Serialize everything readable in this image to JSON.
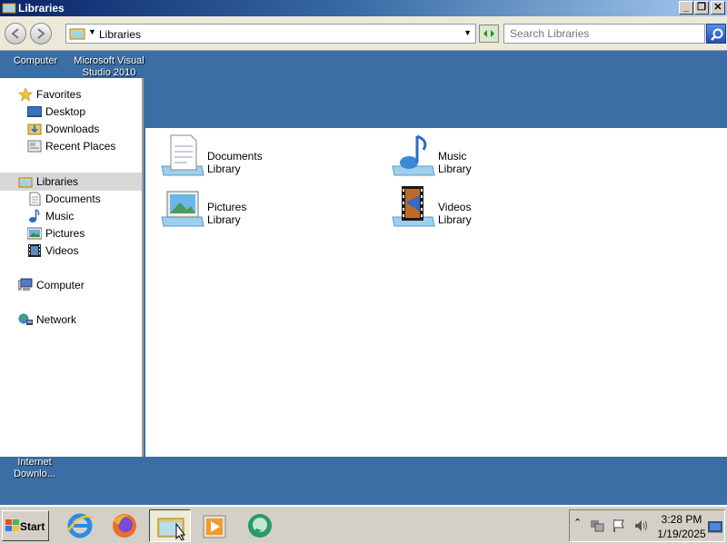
{
  "window": {
    "title": "Libraries",
    "controls": {
      "minimize": "_",
      "restore": "❐",
      "close": "✕"
    }
  },
  "address": {
    "path": "Libraries"
  },
  "search": {
    "placeholder": "Search Libraries"
  },
  "desktop_icons": [
    {
      "label": "Computer"
    },
    {
      "label": "Microsoft Visual Studio 2010"
    },
    {
      "label": "Internet Downlo..."
    }
  ],
  "navpane": {
    "favorites": {
      "label": "Favorites",
      "items": [
        "Desktop",
        "Downloads",
        "Recent Places"
      ]
    },
    "libraries": {
      "label": "Libraries",
      "items": [
        "Documents",
        "Music",
        "Pictures",
        "Videos"
      ]
    },
    "computer": "Computer",
    "network": "Network"
  },
  "libraries": [
    {
      "name": "Documents",
      "type": "Library",
      "icon": "documents-library-icon"
    },
    {
      "name": "Music",
      "type": "Library",
      "icon": "music-library-icon"
    },
    {
      "name": "Pictures",
      "type": "Library",
      "icon": "pictures-library-icon"
    },
    {
      "name": "Videos",
      "type": "Library",
      "icon": "videos-library-icon"
    }
  ],
  "taskbar": {
    "start_label": "Start",
    "apps": [
      "internet-explorer-icon",
      "firefox-icon",
      "windows-explorer-icon",
      "media-player-icon",
      "chat-app-icon"
    ],
    "clock_time": "3:28 PM",
    "clock_date": "1/19/2025"
  },
  "colors": {
    "desktop": "#3a6ea5",
    "titlebar": "#0a246a",
    "selection": "#d8d8d8"
  }
}
